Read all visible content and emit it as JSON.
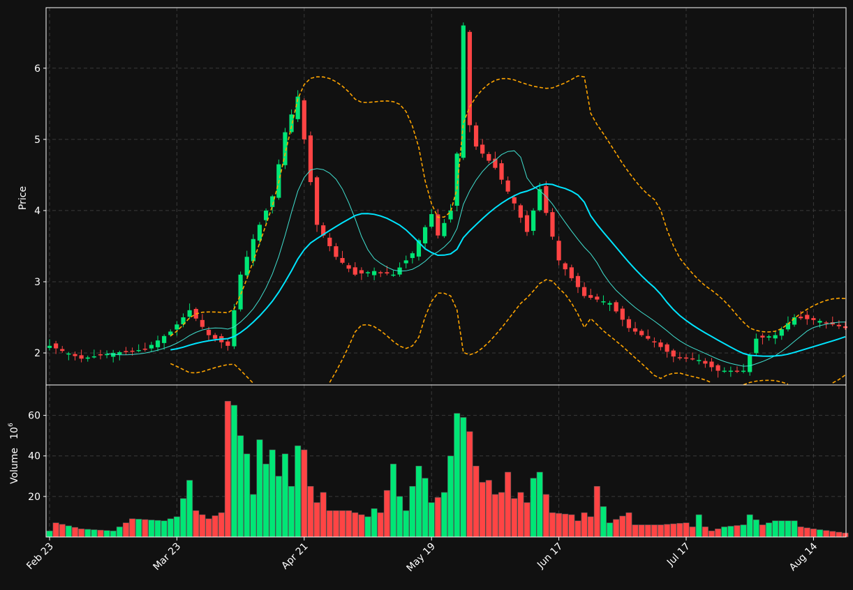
{
  "chart_data": {
    "type": "candlestick",
    "theme": {
      "background": "#111111",
      "grid": "#3a3a3a",
      "axis": "#ffffff",
      "up": "#00e676",
      "down": "#ff4444",
      "ma_fast": "#40e0d0",
      "ma_slow": "#00e5ff",
      "bands": "#ffa500"
    },
    "price_panel": {
      "ylabel": "Price",
      "ylim": [
        1.55,
        6.85
      ],
      "yticks": [
        2,
        3,
        4,
        5,
        6
      ],
      "grid": true
    },
    "volume_panel": {
      "ylabel": "Volume",
      "ylabel_exp": "6",
      "ylim": [
        0,
        75
      ],
      "yticks": [
        20,
        40,
        60
      ],
      "grid": true
    },
    "x_axis": {
      "tick_labels": [
        "Feb 23",
        "Mar 23",
        "Apr 21",
        "May 19",
        "Jun 17",
        "Jul 17",
        "Aug 14"
      ],
      "tick_index": [
        0,
        20,
        40,
        60,
        80,
        100,
        120
      ],
      "n_bars": 126
    },
    "ohlc_anchors": [
      [
        0,
        2.1
      ],
      [
        5,
        1.92
      ],
      [
        10,
        2.0
      ],
      [
        15,
        2.05
      ],
      [
        19,
        2.3
      ],
      [
        22,
        2.6
      ],
      [
        25,
        2.25
      ],
      [
        28,
        2.1
      ],
      [
        30,
        3.1
      ],
      [
        32,
        3.6
      ],
      [
        35,
        4.2
      ],
      [
        37,
        5.1
      ],
      [
        39,
        5.6
      ],
      [
        42,
        3.8
      ],
      [
        45,
        3.35
      ],
      [
        48,
        3.1
      ],
      [
        51,
        3.15
      ],
      [
        54,
        3.1
      ],
      [
        57,
        3.4
      ],
      [
        60,
        3.95
      ],
      [
        61,
        3.65
      ],
      [
        63,
        4.0
      ],
      [
        64,
        4.8
      ],
      [
        65,
        6.6
      ],
      [
        66,
        5.2
      ],
      [
        67,
        4.9
      ],
      [
        70,
        4.6
      ],
      [
        73,
        4.1
      ],
      [
        75,
        3.7
      ],
      [
        77,
        4.3
      ],
      [
        80,
        3.3
      ],
      [
        84,
        2.8
      ],
      [
        88,
        2.7
      ],
      [
        91,
        2.35
      ],
      [
        95,
        2.15
      ],
      [
        98,
        1.95
      ],
      [
        102,
        1.9
      ],
      [
        105,
        1.75
      ],
      [
        109,
        1.75
      ],
      [
        111,
        2.2
      ],
      [
        114,
        2.25
      ],
      [
        117,
        2.5
      ],
      [
        121,
        2.45
      ],
      [
        125,
        2.35
      ]
    ],
    "volume_anchors": [
      [
        0,
        3
      ],
      [
        1,
        7
      ],
      [
        5,
        4
      ],
      [
        10,
        3
      ],
      [
        13,
        9
      ],
      [
        18,
        8
      ],
      [
        20,
        10
      ],
      [
        22,
        28
      ],
      [
        23,
        13
      ],
      [
        25,
        9
      ],
      [
        27,
        12
      ],
      [
        28,
        67
      ],
      [
        29,
        65
      ],
      [
        30,
        50
      ],
      [
        31,
        41
      ],
      [
        32,
        21
      ],
      [
        33,
        48
      ],
      [
        34,
        36
      ],
      [
        35,
        43
      ],
      [
        36,
        30
      ],
      [
        37,
        41
      ],
      [
        38,
        25
      ],
      [
        39,
        45
      ],
      [
        40,
        43
      ],
      [
        41,
        25
      ],
      [
        42,
        17
      ],
      [
        43,
        22
      ],
      [
        44,
        13
      ],
      [
        47,
        13
      ],
      [
        50,
        10
      ],
      [
        51,
        14
      ],
      [
        52,
        12
      ],
      [
        53,
        23
      ],
      [
        54,
        36
      ],
      [
        55,
        20
      ],
      [
        56,
        13
      ],
      [
        57,
        25
      ],
      [
        58,
        35
      ],
      [
        59,
        29
      ],
      [
        60,
        17
      ],
      [
        62,
        22
      ],
      [
        63,
        40
      ],
      [
        64,
        61
      ],
      [
        65,
        59
      ],
      [
        66,
        52
      ],
      [
        67,
        35
      ],
      [
        68,
        27
      ],
      [
        69,
        28
      ],
      [
        70,
        21
      ],
      [
        71,
        22
      ],
      [
        72,
        32
      ],
      [
        73,
        19
      ],
      [
        74,
        22
      ],
      [
        75,
        17
      ],
      [
        76,
        29
      ],
      [
        77,
        32
      ],
      [
        78,
        21
      ],
      [
        79,
        12
      ],
      [
        82,
        11
      ],
      [
        83,
        8
      ],
      [
        84,
        12
      ],
      [
        85,
        10
      ],
      [
        86,
        25
      ],
      [
        87,
        15
      ],
      [
        88,
        7
      ],
      [
        91,
        12
      ],
      [
        92,
        6
      ],
      [
        96,
        6
      ],
      [
        100,
        7
      ],
      [
        101,
        5
      ],
      [
        102,
        11
      ],
      [
        103,
        5
      ],
      [
        104,
        3
      ],
      [
        106,
        5
      ],
      [
        109,
        6
      ],
      [
        110,
        11
      ],
      [
        112,
        6
      ],
      [
        114,
        8
      ],
      [
        117,
        8
      ],
      [
        118,
        5
      ],
      [
        120,
        4
      ],
      [
        125,
        2
      ]
    ]
  }
}
